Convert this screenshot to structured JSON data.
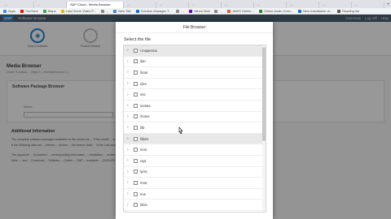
{
  "browser": {
    "tabs": [
      "...",
      "...",
      "...",
      "...",
      "...",
      "...",
      "...",
      "...",
      "...",
      "..."
    ],
    "active_tab": "SAP Cloud - Media Browser",
    "new_tab": "+",
    "bookmarks": [
      {
        "label": "Apps",
        "color": "#4285f4"
      },
      {
        "label": "YouTube",
        "color": "#ff0000"
      },
      {
        "label": "Maps",
        "color": "#34a853"
      },
      {
        "label": "Lula Home Video P...",
        "color": "#f4b400"
      },
      {
        "label": "...",
        "color": "#888888"
      },
      {
        "label": "New Tab",
        "color": "#4285f4"
      },
      {
        "label": "Solution Manager T...",
        "color": "#0a6ed1"
      },
      {
        "label": "...",
        "color": "#888888"
      },
      {
        "label": "Yahoo Mail",
        "color": "#6001d2"
      },
      {
        "label": "...",
        "color": "#888888"
      },
      {
        "label": "JAWS Online...",
        "color": "#e4572e"
      },
      {
        "label": "Online Audio Conv...",
        "color": "#2e7d32"
      },
      {
        "label": "New Installation of...",
        "color": "#0a6ed1"
      },
      {
        "label": "Reading list",
        "color": "#555555"
      }
    ]
  },
  "app": {
    "logo": "SAP",
    "title": "Software Browse",
    "header_right": [
      "Overview",
      "Log Off",
      "Help"
    ],
    "steps": [
      {
        "label": "Select Software"
      },
      {
        "label": "Product Version"
      }
    ],
    "section_title": "Media Browser",
    "section_sub": "Home Solution ... (http://..../media/browser...)",
    "panel_title": "Software Package Browser",
    "field_label": "Select",
    "field_value": "...",
    "additional_title": "Additional Information",
    "paragraphs": [
      "The complete software packages available on the media are ... If the media ... browse ... below ...",
      "If the following data are ... license ... please ... the licence data ... in the Link area ...",
      "The signature ... is installed ... corresponding information ... installation ... ordered ...",
      "Note: ... see ... Download ... Software ... Center ... SAP ... available ... (2020/2021)."
    ]
  },
  "dialog": {
    "title": "File Browser",
    "subtitle": "Select the file",
    "items": [
      {
        "label": "/ inspection",
        "highlight": true
      },
      {
        "label": "/bin"
      },
      {
        "label": "/boot"
      },
      {
        "label": "/dev"
      },
      {
        "label": "/etc"
      },
      {
        "label": "/extras"
      },
      {
        "label": "/home"
      },
      {
        "label": "/lib"
      },
      {
        "label": "/lib64",
        "highlight": true
      },
      {
        "label": "/mnt"
      },
      {
        "label": "/opt"
      },
      {
        "label": "/proc"
      },
      {
        "label": "/root"
      },
      {
        "label": "/run"
      },
      {
        "label": "/sbin"
      }
    ]
  }
}
